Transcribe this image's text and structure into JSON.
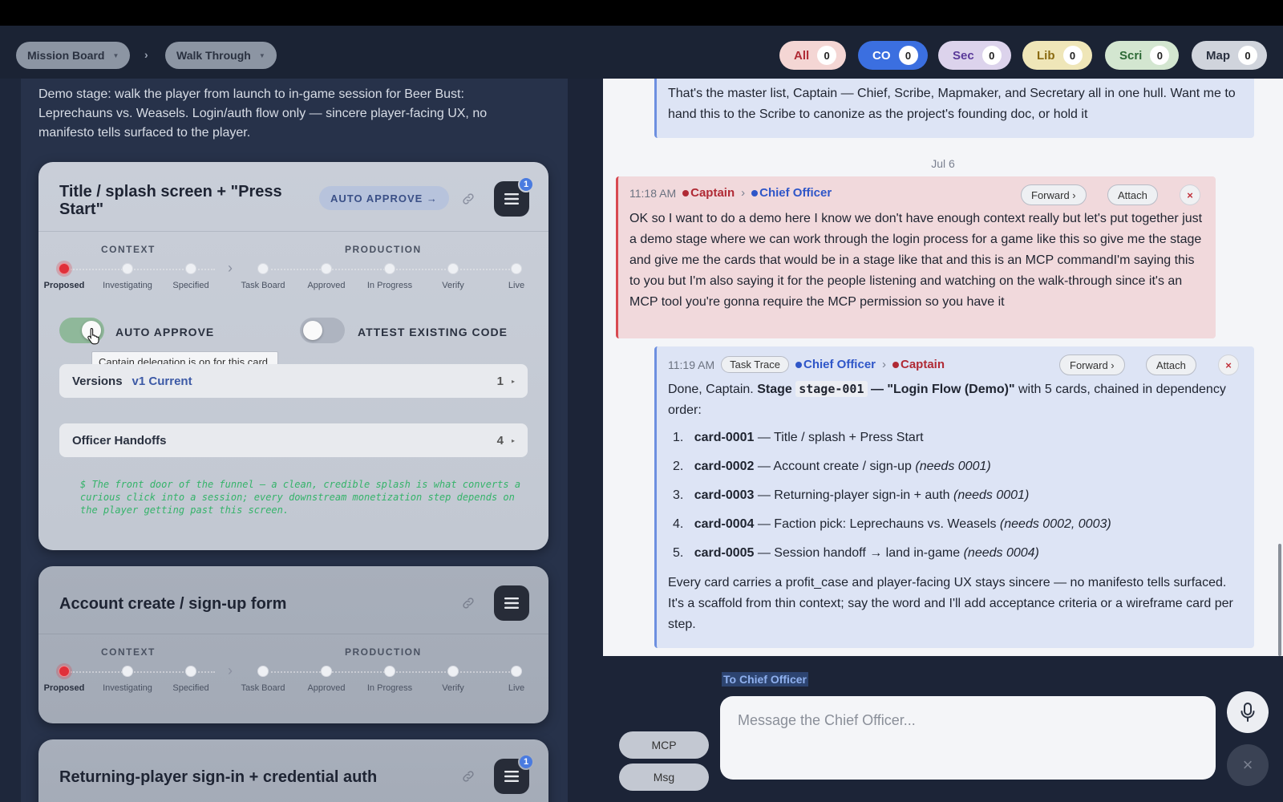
{
  "breadcrumb": {
    "items": [
      {
        "label": "Mission Board"
      },
      {
        "label": "Walk Through"
      }
    ],
    "separator": "›"
  },
  "filters": [
    {
      "label": "All",
      "count": "0",
      "bg": "#f4d6d4",
      "fg": "#b02a35"
    },
    {
      "label": "CO",
      "count": "0",
      "bg": "#3b6fe0",
      "fg": "#ffffff"
    },
    {
      "label": "Sec",
      "count": "0",
      "bg": "#dcd3ec",
      "fg": "#5a3a9a"
    },
    {
      "label": "Lib",
      "count": "0",
      "bg": "#efe6b8",
      "fg": "#8a6a10"
    },
    {
      "label": "Scri",
      "count": "0",
      "bg": "#d3e6d0",
      "fg": "#2e6a36"
    },
    {
      "label": "Map",
      "count": "0",
      "bg": "#d0d4dc",
      "fg": "#2a3140"
    }
  ],
  "stage": {
    "description": "Demo stage: walk the player from launch to in-game session for Beer Bust: Leprechauns vs. Weasels. Login/auth flow only — sincere player-facing UX, no manifesto tells surfaced to the player."
  },
  "pipeline": {
    "context_label": "CONTEXT",
    "production_label": "PRODUCTION",
    "stages": [
      "Proposed",
      "Investigating",
      "Specified",
      "Task Board",
      "Approved",
      "In Progress",
      "Verify",
      "Live"
    ]
  },
  "cards": [
    {
      "title_line1": "Title / splash screen + \"Press",
      "title_line2": "Start\"",
      "auto_approve_btn": "AUTO APPROVE →",
      "badge": "1",
      "toggle_auto_label": "AUTO APPROVE",
      "toggle_attest_label": "ATTEST EXISTING CODE",
      "tooltip": "Captain delegation is on for this card.",
      "versions_label": "Versions",
      "versions_value": "v1 Current",
      "versions_count": "1",
      "handoffs_label": "Officer Handoffs",
      "handoffs_count": "4",
      "note": "$ The front door of the funnel — a clean, credible splash is what converts a curious click into a session; every downstream monetization step depends on the player getting past this screen."
    },
    {
      "title": "Account create / sign-up form"
    },
    {
      "title": "Returning-player sign-in + credential auth",
      "badge": "1"
    }
  ],
  "chat": {
    "prev_message": "That's the master list, Captain — Chief, Scribe, Mapmaker, and Secretary all in one hull. Want me to hand this to the Scribe to canonize as the project's founding doc, or hold it",
    "date_separator": "Jul 6",
    "captain_msg": {
      "time": "11:18 AM",
      "from": "Captain",
      "arrow": "›",
      "to": "Chief Officer",
      "forward": "Forward ›",
      "attach": "Attach",
      "close": "×",
      "text": "OK so I want to do a demo here I know we don't have enough context really but let's put together just a demo stage where we can work through the login process for a game like this so give me the stage and give me the cards that would be in a stage like that and this is an MCP commandI'm saying this to you but I'm also saying it for the people listening and watching on the walk-through since it's an MCP tool you're gonna require the MCP permission so you have it"
    },
    "officer_msg": {
      "time": "11:19 AM",
      "tag": "Task Trace",
      "from": "Chief Officer",
      "arrow": "›",
      "to": "Captain",
      "forward": "Forward ›",
      "attach": "Attach",
      "close": "×",
      "intro_a": "Done, Captain. ",
      "intro_stage": "Stage",
      "intro_code": "stage-001",
      "intro_b": " — \"Login Flow (Demo)\"",
      "intro_c": " with 5 cards, chained in dependency order:",
      "items": [
        {
          "num": "1.",
          "id": "card-0001",
          "text": " — Title / splash + Press Start",
          "dep": ""
        },
        {
          "num": "2.",
          "id": "card-0002",
          "text": " — Account create / sign-up ",
          "dep": "(needs 0001)"
        },
        {
          "num": "3.",
          "id": "card-0003",
          "text": " — Returning-player sign-in + auth ",
          "dep": "(needs 0001)"
        },
        {
          "num": "4.",
          "id": "card-0004",
          "text": " — Faction pick: Leprechauns vs. Weasels ",
          "dep": "(needs 0002, 0003)"
        },
        {
          "num": "5.",
          "id": "card-0005",
          "text": " — Session handoff → land in-game ",
          "dep": "(needs 0004)"
        }
      ],
      "outro": "Every card carries a profit_case and player-facing UX stays sincere — no manifesto tells surfaced. It's a scaffold from thin context; say the word and I'll add acceptance criteria or a wireframe card per step."
    }
  },
  "composer": {
    "to_label": "To Chief Officer",
    "placeholder": "Message the Chief Officer...",
    "mcp_label": "MCP",
    "msg_label": "Msg",
    "close": "×"
  }
}
